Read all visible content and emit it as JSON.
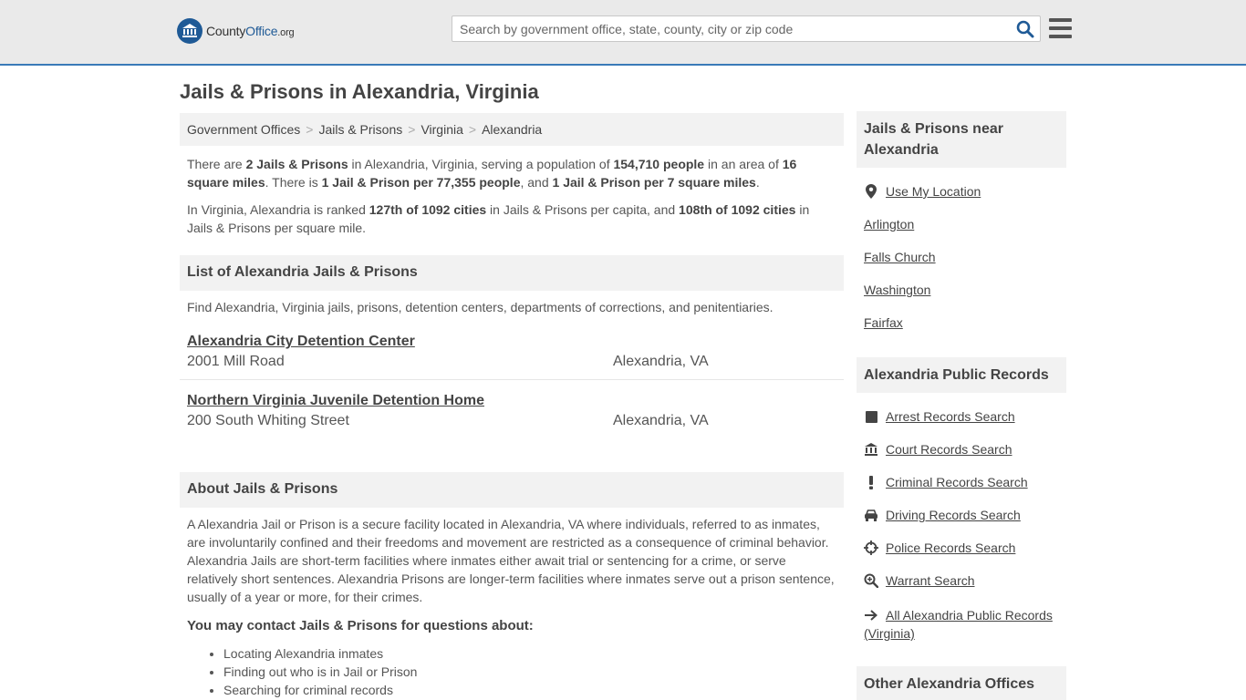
{
  "header": {
    "logo": {
      "county": "County",
      "office": "Office",
      "org": ".org"
    },
    "search_placeholder": "Search by government office, state, county, city or zip code"
  },
  "page": {
    "title": "Jails & Prisons in Alexandria, Virginia"
  },
  "breadcrumb": [
    "Government Offices",
    "Jails & Prisons",
    "Virginia",
    "Alexandria"
  ],
  "intro": {
    "p1": {
      "t1": "There are ",
      "b1": "2 Jails & Prisons",
      "t2": " in Alexandria, Virginia, serving a population of ",
      "b2": "154,710 people",
      "t3": " in an area of ",
      "b3": "16 square miles",
      "t4": ". There is ",
      "b4": "1 Jail & Prison per 77,355 people",
      "t5": ", and ",
      "b5": "1 Jail & Prison per 7 square miles",
      "t6": "."
    },
    "p2": {
      "t1": "In Virginia, Alexandria is ranked ",
      "b1": "127th of 1092 cities",
      "t2": " in Jails & Prisons per capita, and ",
      "b2": "108th of 1092 cities",
      "t3": " in Jails & Prisons per square mile."
    }
  },
  "list_section": {
    "heading": "List of Alexandria Jails & Prisons",
    "description": "Find Alexandria, Virginia jails, prisons, detention centers, departments of corrections, and penitentiaries.",
    "items": [
      {
        "name": "Alexandria City Detention Center",
        "address": "2001 Mill Road",
        "city": "Alexandria, VA"
      },
      {
        "name": "Northern Virginia Juvenile Detention Home",
        "address": "200 South Whiting Street",
        "city": "Alexandria, VA"
      }
    ]
  },
  "about_section": {
    "heading": "About Jails & Prisons",
    "text": "A Alexandria Jail or Prison is a secure facility located in Alexandria, VA where individuals, referred to as inmates, are involuntarily confined and their freedoms and movement are restricted as a consequence of criminal behavior. Alexandria Jails are short-term facilities where inmates either await trial or sentencing for a crime, or serve relatively short sentences. Alexandria Prisons are longer-term facilities where inmates serve out a prison sentence, usually of a year or more, for their crimes.",
    "contact_heading": "You may contact Jails & Prisons for questions about:",
    "bullets": [
      "Locating Alexandria inmates",
      "Finding out who is in Jail or Prison",
      "Searching for criminal records"
    ]
  },
  "sidebar": {
    "nearby": {
      "heading": "Jails & Prisons near Alexandria",
      "use_location": "Use My Location",
      "places": [
        "Arlington",
        "Falls Church",
        "Washington",
        "Fairfax"
      ]
    },
    "records": {
      "heading": "Alexandria Public Records",
      "links": [
        {
          "label": "Arrest Records Search",
          "icon": "square-icon"
        },
        {
          "label": "Court Records Search",
          "icon": "courthouse-icon"
        },
        {
          "label": "Criminal Records Search",
          "icon": "exclamation-icon"
        },
        {
          "label": "Driving Records Search",
          "icon": "car-icon"
        },
        {
          "label": "Police Records Search",
          "icon": "crosshair-icon"
        },
        {
          "label": "Warrant Search",
          "icon": "magnify-icon"
        },
        {
          "label": "All Alexandria Public Records (Virginia)",
          "icon": "arrow-right-icon"
        }
      ]
    },
    "other": {
      "heading": "Other Alexandria Offices"
    }
  },
  "colors": {
    "accent": "#1f5a96",
    "header_bg": "#eaeaea",
    "section_bg": "#f2f2f2"
  }
}
